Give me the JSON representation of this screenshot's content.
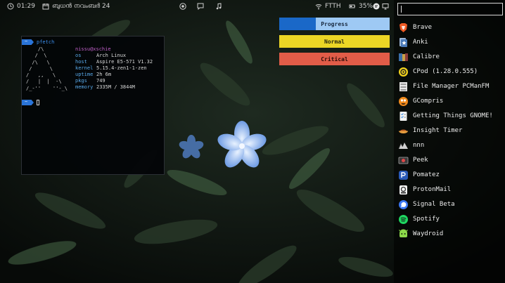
{
  "topbar": {
    "clock_icon": "clock-icon",
    "time": "01:29",
    "date": "ബുധൻ നവംബർ 24",
    "center_icons": [
      "firefox-icon",
      "chat-icon",
      "music-note-icon"
    ],
    "wifi_icon": "wifi-icon",
    "network": "FTTH",
    "battery_icon": "battery-icon",
    "battery": "35%",
    "tray_icons": [
      "notification-icon",
      "display-icon"
    ]
  },
  "terminal": {
    "command": "pfetch",
    "user_host": "nissu@xschie",
    "logo": "    /\\\n   /  \\\n  /\\   \\\n /      \\\n/   ,,   \\\n/   |  |  -\\\n/_-''    ''-_\\",
    "info": [
      {
        "key": "os",
        "value": "Arch Linux"
      },
      {
        "key": "host",
        "value": "Aspire E5-571 V1.32"
      },
      {
        "key": "kernel",
        "value": "5.15.4-zen1-1-zen"
      },
      {
        "key": "uptime",
        "value": "2h 6m"
      },
      {
        "key": "pkgs",
        "value": "749"
      },
      {
        "key": "memory",
        "value": "2335M / 3844M"
      }
    ]
  },
  "bars": {
    "progress": {
      "label": "Progress",
      "level": 0.33
    },
    "normal": {
      "label": "Normal"
    },
    "critical": {
      "label": "Critical"
    }
  },
  "launcher": {
    "search_value": "",
    "apps": [
      {
        "name": "Brave",
        "icon": "brave-icon"
      },
      {
        "name": "Anki",
        "icon": "anki-icon"
      },
      {
        "name": "Calibre",
        "icon": "calibre-icon"
      },
      {
        "name": "CPod (1.28.0.555)",
        "icon": "cpod-icon"
      },
      {
        "name": "File Manager PCManFM",
        "icon": "file-manager-icon"
      },
      {
        "name": "GCompris",
        "icon": "gcompris-icon"
      },
      {
        "name": "Getting Things GNOME!",
        "icon": "gtg-icon"
      },
      {
        "name": "Insight Timer",
        "icon": "insight-timer-icon"
      },
      {
        "name": "nnn",
        "icon": "nnn-icon"
      },
      {
        "name": "Peek",
        "icon": "peek-icon"
      },
      {
        "name": "Pomatez",
        "icon": "pomatez-icon"
      },
      {
        "name": "ProtonMail",
        "icon": "protonmail-icon"
      },
      {
        "name": "Signal Beta",
        "icon": "signal-icon"
      },
      {
        "name": "Spotify",
        "icon": "spotify-icon"
      },
      {
        "name": "Waydroid",
        "icon": "waydroid-icon"
      }
    ]
  },
  "colors": {
    "progress_fill": "#1a68c8",
    "progress_track": "#9ec9f4",
    "normal": "#ecd625",
    "critical": "#e15c48",
    "prompt_accent": "#2a74d8"
  }
}
